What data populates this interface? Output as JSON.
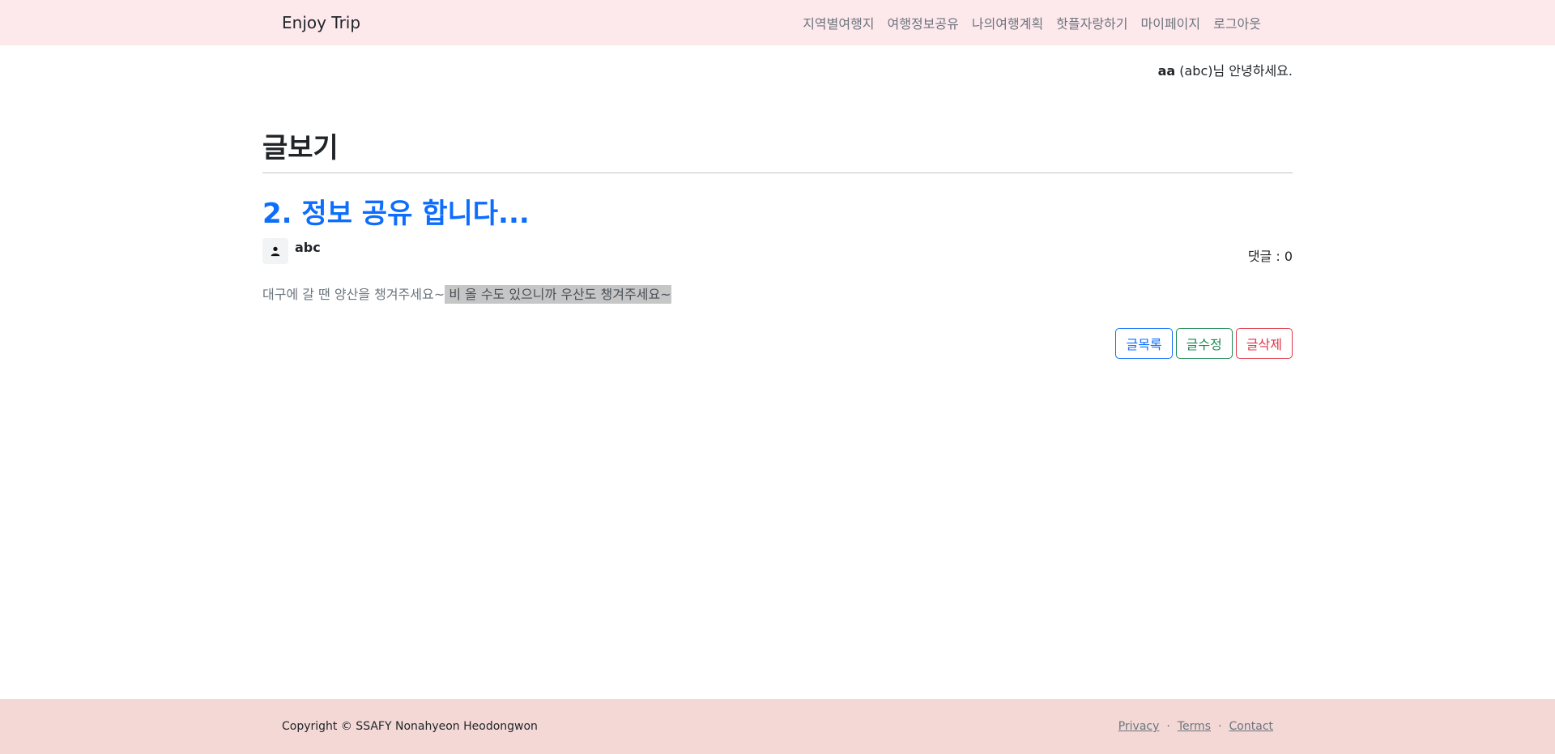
{
  "nav": {
    "brand": "Enjoy Trip",
    "items": [
      "지역별여행지",
      "여행정보공유",
      "나의여행계획",
      "핫플자랑하기",
      "마이페이지",
      "로그아웃"
    ]
  },
  "greeting": {
    "user_id": "aa",
    "rest": " (abc)님 안녕하세요."
  },
  "page": {
    "title": "글보기"
  },
  "article": {
    "title": "2. 정보 공유 합니다...",
    "author": "abc",
    "comment_label": "댓글 : 0",
    "content_plain": "대구에 갈 땐 양산을 챙겨주세요~",
    "content_highlighted": " 비 올 수도 있으니까 우산도 챙겨주세요~"
  },
  "buttons": {
    "list": "글목록",
    "edit": "글수정",
    "delete": "글삭제"
  },
  "footer": {
    "copyright": "Copyright © SSAFY Nonahyeon Heodongwon",
    "links": [
      "Privacy",
      "Terms",
      "Contact"
    ],
    "separator": "·"
  },
  "icons": {
    "avatar": "person-icon"
  },
  "colors": {
    "navbar_bg": "#fde8ec",
    "footer_bg": "#f3d8d6",
    "primary": "#0d6efd",
    "success": "#198754",
    "danger": "#dc3545"
  }
}
